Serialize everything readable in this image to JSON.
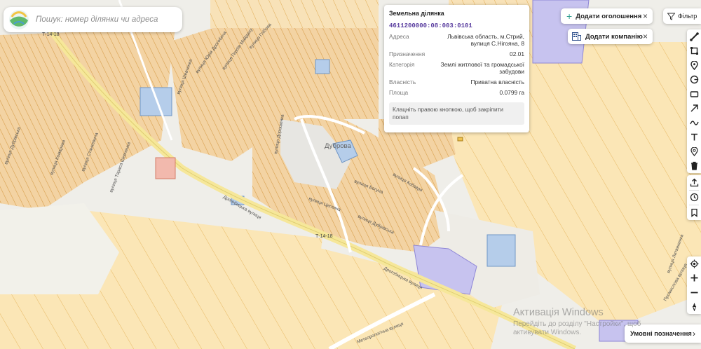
{
  "search": {
    "placeholder": "Пошук: номер ділянки чи адреса"
  },
  "popup": {
    "title": "Земельна ділянка",
    "cadastral_number": "4611200000:08:003:0101",
    "fields": [
      {
        "label": "Адреса",
        "value": "Львівська область, м.Стрий, вулиця С.Нігояна, 8"
      },
      {
        "label": "Призначення",
        "value": "02.01"
      },
      {
        "label": "Категорія",
        "value": "Землі житлової та громадської забудови"
      },
      {
        "label": "Власність",
        "value": "Приватна власність"
      },
      {
        "label": "Площа",
        "value": "0.0799 га"
      }
    ],
    "hint": "Клацніть правою кнопкою, щоб закріпити попап"
  },
  "buttons": {
    "add_listing": "Додати оголошення",
    "add_company": "Додати компанію",
    "filter": "Фільтр",
    "legend": "Умовні позначення",
    "close": "×",
    "chevron": "›",
    "plus": "+"
  },
  "map": {
    "district": "Дуброва",
    "road_code": "Т-14-18",
    "streets": [
      "Дрогобицька вулиця",
      "Дрогобицька вулиця",
      "вулиця Дубрівська",
      "вулиця Шевченка",
      "вулиця Юрія Дрогобича",
      "вулиця Героїв Майдану",
      "вулиця Глібова",
      "вулиця Станкевича",
      "вулиця Тараса Шевченка",
      "вулиця Комарова",
      "вулиця Дорошенка",
      "вулиця Богуна",
      "вулиця Кобзаря",
      "вулиця Цегляна",
      "вулиця Дубрівська",
      "Метеорологічна вулиця",
      "Промислова вулиця",
      "вулиця Литвиненка"
    ]
  },
  "tools": [
    "ruler-icon",
    "polygon-icon",
    "pin-icon",
    "circle-icon",
    "rectangle-icon",
    "arrow-icon",
    "freehand-icon",
    "text-icon",
    "location-icon",
    "trash-icon",
    "upload-icon",
    "clock-icon",
    "bookmark-icon",
    "locate-icon",
    "zoom-in-icon",
    "zoom-out-icon",
    "compass-icon"
  ],
  "watermark": {
    "title": "Активація Windows",
    "subtitle": "Перейдіть до розділу \"Настройки\", щоб активувати Windows."
  }
}
